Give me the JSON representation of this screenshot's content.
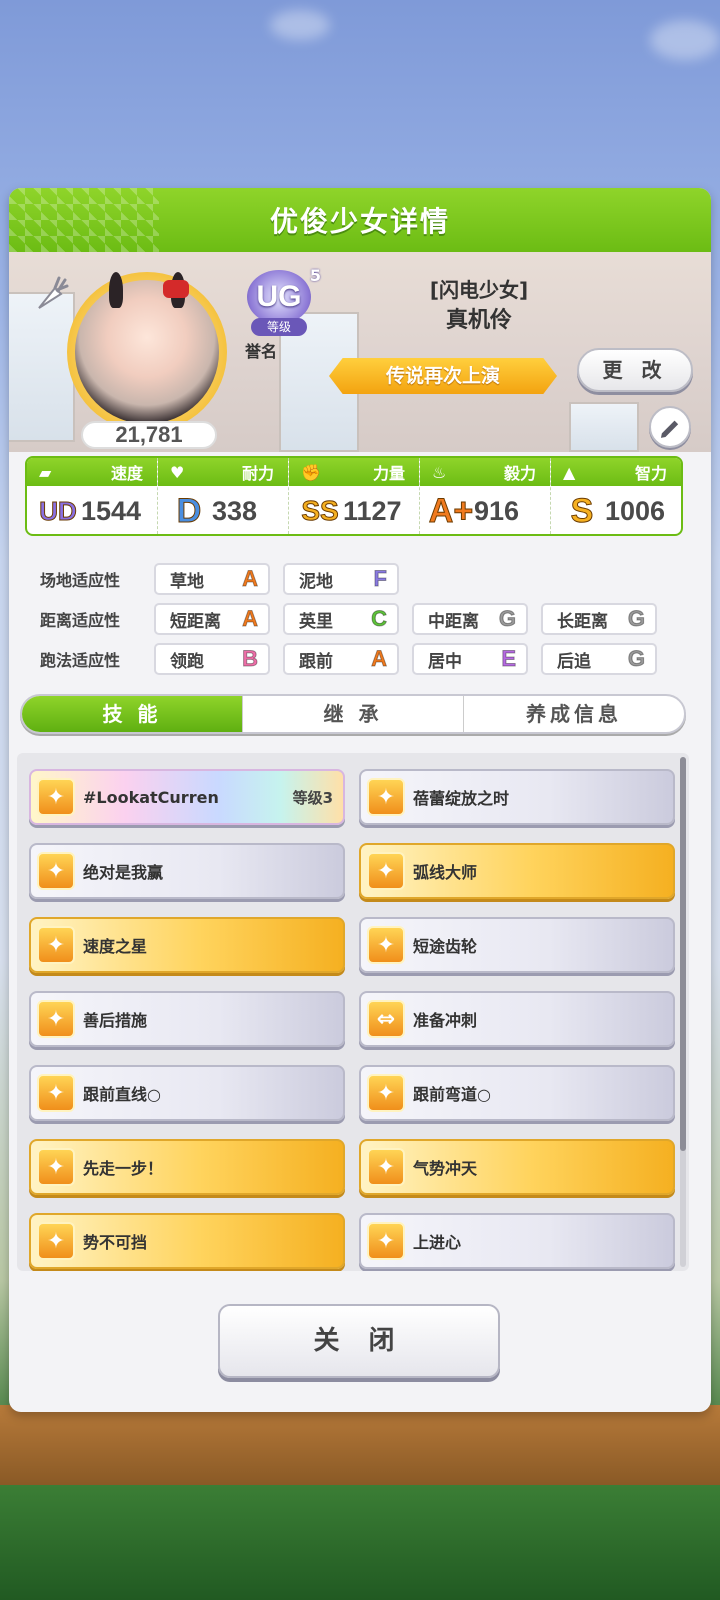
{
  "panel_title": "优俊少女详情",
  "profile": {
    "fan_count": "21,781",
    "rank_badge": "UG",
    "rank_level": "5",
    "rank_label": "等级",
    "honor_label": "誉名",
    "epithet": "[闪电少女]",
    "name": "真机伶",
    "title_ribbon": "传说再次上演",
    "change_label": "更 改"
  },
  "stats": [
    {
      "name": "速度",
      "grade": "UD",
      "grade_sub": "4",
      "value": "1544",
      "grade_color": "#8a6fe0"
    },
    {
      "name": "耐力",
      "grade": "D",
      "value": "338",
      "grade_color": "#4a8ee0"
    },
    {
      "name": "力量",
      "grade": "SS",
      "value": "1127",
      "grade_color": "#f5b021"
    },
    {
      "name": "毅力",
      "grade": "A+",
      "value": "916",
      "grade_color": "#f07a1e"
    },
    {
      "name": "智力",
      "grade": "S",
      "value": "1006",
      "grade_color": "#f5b021"
    }
  ],
  "aptitudes": {
    "field": {
      "label": "场地适应性",
      "items": [
        {
          "name": "草地",
          "grade": "A",
          "color": "#f07a1e"
        },
        {
          "name": "泥地",
          "grade": "F",
          "color": "#8a7be0"
        }
      ]
    },
    "distance": {
      "label": "距离适应性",
      "items": [
        {
          "name": "短距离",
          "grade": "A",
          "color": "#f07a1e"
        },
        {
          "name": "英里",
          "grade": "C",
          "color": "#5ec23a"
        },
        {
          "name": "中距离",
          "grade": "G",
          "color": "#9a9a9a"
        },
        {
          "name": "长距离",
          "grade": "G",
          "color": "#9a9a9a"
        }
      ]
    },
    "style": {
      "label": "跑法适应性",
      "items": [
        {
          "name": "领跑",
          "grade": "B",
          "color": "#ee6fa8"
        },
        {
          "name": "跟前",
          "grade": "A",
          "color": "#f07a1e"
        },
        {
          "name": "居中",
          "grade": "E",
          "color": "#b56be0"
        },
        {
          "name": "后追",
          "grade": "G",
          "color": "#9a9a9a"
        }
      ]
    }
  },
  "tabs": [
    "技 能",
    "继 承",
    "养成信息"
  ],
  "skills": [
    {
      "name": "#LookatCurren",
      "level": "等级3",
      "style": "rainbow"
    },
    {
      "name": "蓓蕾绽放之时",
      "style": "silver"
    },
    {
      "name": "绝对是我赢",
      "style": "silver"
    },
    {
      "name": "弧线大师",
      "style": "gold"
    },
    {
      "name": "速度之星",
      "style": "gold"
    },
    {
      "name": "短途齿轮",
      "style": "silver"
    },
    {
      "name": "善后措施",
      "style": "silver"
    },
    {
      "name": "准备冲刺",
      "style": "silver"
    },
    {
      "name": "跟前直线○",
      "style": "silver"
    },
    {
      "name": "跟前弯道○",
      "style": "silver"
    },
    {
      "name": "先走一步！",
      "style": "gold"
    },
    {
      "name": "气势冲天",
      "style": "gold"
    },
    {
      "name": "势不可挡",
      "style": "gold"
    },
    {
      "name": "上进心",
      "style": "silver"
    }
  ],
  "close_label": "关 闭"
}
